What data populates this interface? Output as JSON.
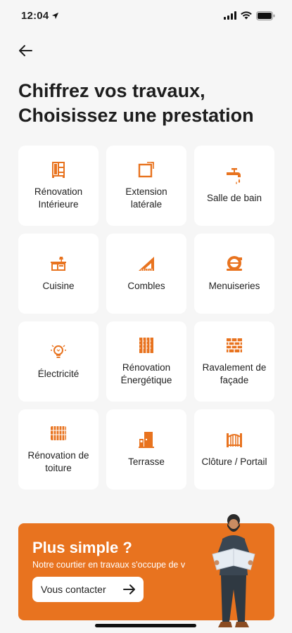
{
  "status": {
    "time": "12:04"
  },
  "title": {
    "line1": "Chiffrez vos travaux,",
    "line2": "Choisissez une prestation"
  },
  "tiles": [
    {
      "label": "Rénovation Intérieure",
      "icon": "cabinet-icon"
    },
    {
      "label": "Extension latérale",
      "icon": "extension-icon"
    },
    {
      "label": "Salle de bain",
      "icon": "faucet-icon"
    },
    {
      "label": "Cuisine",
      "icon": "kitchen-icon"
    },
    {
      "label": "Combles",
      "icon": "set-square-icon"
    },
    {
      "label": "Menuiseries",
      "icon": "window-icon"
    },
    {
      "label": "Électricité",
      "icon": "lightbulb-icon"
    },
    {
      "label": "Rénovation Énergétique",
      "icon": "insulation-icon"
    },
    {
      "label": "Ravalement de façade",
      "icon": "brick-wall-icon"
    },
    {
      "label": "Rénovation de toiture",
      "icon": "roof-icon"
    },
    {
      "label": "Terrasse",
      "icon": "door-icon"
    },
    {
      "label": "Clôture / Portail",
      "icon": "gate-icon"
    }
  ],
  "promo": {
    "title": "Plus simple ?",
    "subtitle": "Notre courtier en travaux s'occupe de v",
    "button_label": "Vous contacter"
  },
  "colors": {
    "accent": "#e8731f",
    "background": "#f6f6f6",
    "tile": "#ffffff"
  }
}
